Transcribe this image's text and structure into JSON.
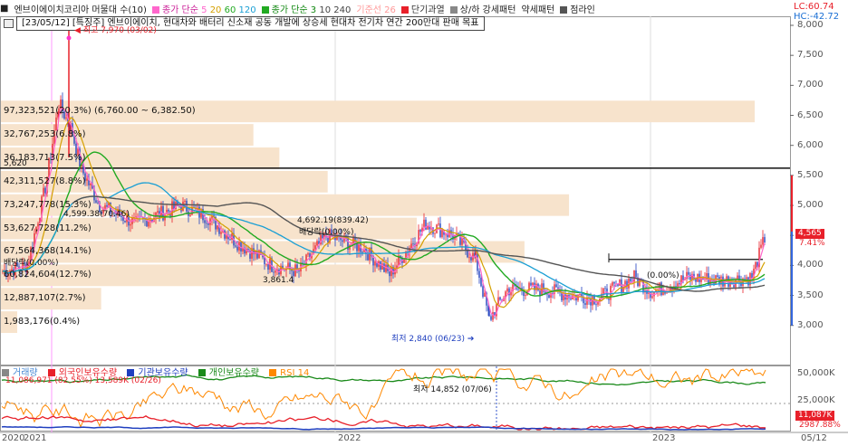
{
  "legend": {
    "title": "엔브이에이치코리아 머물대 수(10)",
    "ma_price_label": "종가 단순",
    "ma_price_periods": [
      "5",
      "20",
      "60",
      "120"
    ],
    "ma_vol_label": "종가 단순",
    "ma_vol_periods": [
      "3",
      "10",
      "240"
    ],
    "baseline": "기준선 26",
    "short_overheat": "단기과열",
    "updown": "상/하 강세패턴",
    "weak_pattern": "약세패턴",
    "dotted_line": "점라인"
  },
  "colors": {
    "candle_up": "#e8202a",
    "candle_down": "#1f3fbf",
    "ma5": "#ff66cc",
    "ma20": "#d4a000",
    "ma60": "#22aa22",
    "ma120": "#1a9fd4",
    "ma240": "#555555",
    "volume_profile": "#f7e3cc",
    "foreign": "#e8202a",
    "institution": "#1f3fbf",
    "individual": "#1a8a1a",
    "rsi": "#ff8800"
  },
  "news": "[23/05/12] [특징주] 엔브이에이치, 현대차와 배터리 신소재 공동 개발에 상승세 현대차 전기차 연간 200만대 판매 목표",
  "indicators": {
    "lc": "LC:60.74",
    "hc": "HC:-42.72"
  },
  "price_axis": [
    "8,000",
    "7,500",
    "7,000",
    "6,500",
    "6,000",
    "5,500",
    "5,000",
    "4,500",
    "4,000",
    "3,500",
    "3,000"
  ],
  "current_price": {
    "value": "4,565",
    "change": "7.41%"
  },
  "line_5620": "5,620",
  "annotations": {
    "high": "최고 7,970 (03/02)",
    "low": "최저 2,840 (06/23)",
    "a1": "4,599.38(70.46)",
    "a2": "4,692.19(839.42)",
    "a3": "배당락(0.00%)",
    "a4": "3,861.4",
    "a5": "(0.00%)",
    "a6": "배당락(0.00%)",
    "lowmark": "최저 14,852 (07/06)"
  },
  "volume_profile": [
    {
      "label": "97,323,521(20.3%) (6,760.00 ~ 6,382.50)",
      "pct": 20.3
    },
    {
      "label": "32,767,253(6.8%)",
      "pct": 6.8
    },
    {
      "label": "36,183,713(7.5%)",
      "pct": 7.5
    },
    {
      "label": "42,311,527(8.8%)",
      "pct": 8.8
    },
    {
      "label": "73,247,778(15.3%)",
      "pct": 15.3
    },
    {
      "label": "53,627,728(11.2%)",
      "pct": 11.2
    },
    {
      "label": "67,564,368(14.1%)",
      "pct": 14.1
    },
    {
      "label": "60,824,604(12.7%)",
      "pct": 12.7
    },
    {
      "label": "12,887,107(2.7%)",
      "pct": 2.7
    },
    {
      "label": "1,983,176(0.4%)",
      "pct": 0.4
    }
  ],
  "sub_legend": {
    "volume": "거래량",
    "foreign": "외국인보유수량",
    "institution": "기관보유수량",
    "individual": "개인보유수량",
    "rsi": "RSI 14",
    "value1": "11,086,971",
    "value2": "(82.55%)",
    "value3": "13,589K (02/26)"
  },
  "sub_axis": [
    "50,000K",
    "25,000K"
  ],
  "sub_tags": {
    "foreign": "11,087K",
    "pct": "2987.88%"
  },
  "time_axis": [
    "2020",
    "2021",
    "2022",
    "2023",
    "05/12"
  ]
}
